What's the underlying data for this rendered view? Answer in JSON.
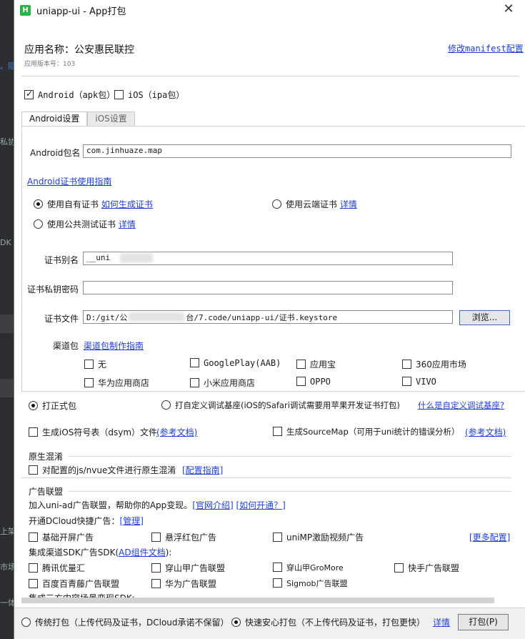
{
  "window": {
    "title": "uniapp-ui - App打包"
  },
  "app": {
    "name": "应用名称：公安惠民联控",
    "version": "应用版本号：103",
    "manifest_link": "修改manifest配置"
  },
  "platforms": {
    "android": "Android（apk包）",
    "ios": "iOS（ipa包）"
  },
  "tabs": [
    "Android设置",
    "iOS设置"
  ],
  "android": {
    "package_label": "Android包名",
    "package_value": "com.jinhuaze.map",
    "cert_guide": "Android证书使用指南",
    "own_cert": "使用自有证书",
    "own_cert_link": "如何生成证书",
    "cloud_cert": "使用云端证书",
    "cloud_cert_link": "详情",
    "public_cert": "使用公共测试证书",
    "public_cert_link": "详情",
    "alias_label": "证书别名",
    "alias_value": "__uni",
    "password_label": "证书私钥密码",
    "password_value": "",
    "file_label": "证书文件",
    "file_value_a": "D:/git/公",
    "file_value_b": "台/7.code/uniapp-ui/证书.keystore",
    "browse": "浏览...",
    "channel_label": "渠道包",
    "channel_link": "渠道包制作指南",
    "channels": [
      "无",
      "GooglePlay(AAB)",
      "应用宝",
      "360应用市场",
      "华为应用商店",
      "小米应用商店",
      "OPPO",
      "VIVO"
    ]
  },
  "build": {
    "formal": "打正式包",
    "custom_base": "打自定义调试基座(iOS的Safari调试需要用苹果开发证书打包)",
    "custom_base_link": "什么是自定义调试基座?",
    "dsym": "生成iOS符号表（dsym）文件",
    "dsym_link": "(参考文档)",
    "sourcemap": "生成SourceMap（可用于uni统计的错误分析）",
    "sourcemap_link": "(参考文档)"
  },
  "obfuscation": {
    "title": "原生混淆",
    "option": "对配置的js/nvue文件进行原生混淆",
    "link": "[配置指南]"
  },
  "ads": {
    "title": "广告联盟",
    "join_text": "加入uni-ad广告联盟，帮助你的App变现。",
    "intro_link": "[官网介绍]",
    "open_link": "[如何开通？]",
    "dcloud_text": "开通DCloud快捷广告：",
    "manage_link": "[管理]",
    "more_link": "[更多配置]",
    "splash": "基础开屏广告",
    "redpacket": "悬浮红包广告",
    "video": "uniMP激励视频广告",
    "sdk_text": "集成渠道SDK广告SDK(",
    "sdk_link": "AD组件文档",
    "sdk_text_end": "):",
    "sdk_items": [
      "腾讯优量汇",
      "穿山甲广告联盟",
      "穿山甲GroMore",
      "快手广告联盟",
      "百度百青藤广告联盟",
      "华为广告联盟",
      "Sigmob广告联盟"
    ],
    "third_party_text": "集成三方内容场景变现SDK:"
  },
  "footer": {
    "traditional": "传统打包（上传代码及证书，DCloud承诺不保留）",
    "fast": "快速安心打包（不上传代码及证书，打包更快）",
    "details_link": "详情",
    "pack_button": "打包(P)"
  },
  "background_fragments": [
    "。隐",
    "私协",
    "DK",
    "上架",
    "市场",
    "一体"
  ]
}
